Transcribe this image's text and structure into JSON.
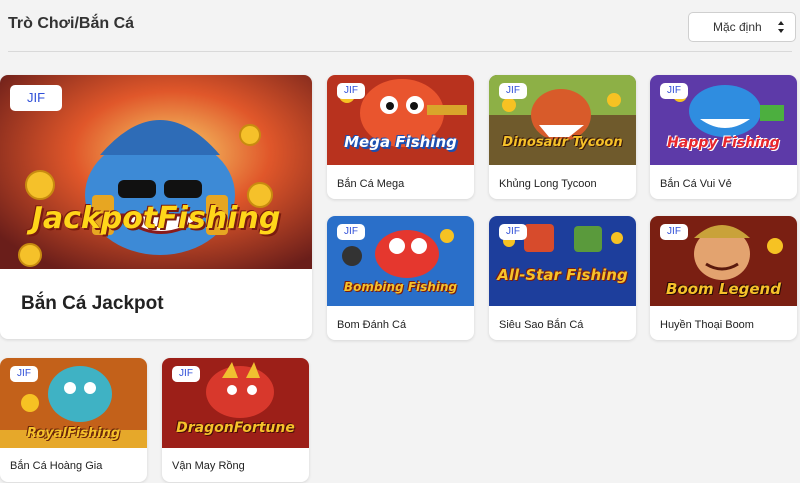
{
  "header": {
    "title": "Trò Chơi/Bắn Cá",
    "sort_label": "Mặc định"
  },
  "badge": "JIF",
  "games": [
    {
      "name": "Bắn Cá Jackpot",
      "logo": "JackpotFishing",
      "colors": {
        "bg": "#c0391b",
        "accent": "#f7c21b"
      }
    },
    {
      "name": "Bắn Cá Mega",
      "logo": "Mega Fishing",
      "colors": {
        "bg": "#b8321e",
        "accent": "#2e6fe0"
      }
    },
    {
      "name": "Khủng Long Tycoon",
      "logo": "Dinosaur Tycoon",
      "colors": {
        "bg": "#a8461c",
        "accent": "#f2b33a"
      }
    },
    {
      "name": "Bắn Cá Vui Vẻ",
      "logo": "Happy Fishing",
      "colors": {
        "bg": "#5d3aa8",
        "accent": "#e8262c"
      }
    },
    {
      "name": "Bom Đánh Cá",
      "logo": "Bombing Fishing",
      "colors": {
        "bg": "#2a6fc9",
        "accent": "#e5372e"
      }
    },
    {
      "name": "Siêu Sao Bắn Cá",
      "logo": "All-Star Fishing",
      "colors": {
        "bg": "#1d3e9c",
        "accent": "#f5c11d"
      }
    },
    {
      "name": "Huyền Thoại Boom",
      "logo": "Boom Legend",
      "colors": {
        "bg": "#7a1f12",
        "accent": "#f5b827"
      }
    },
    {
      "name": "Bắn Cá Hoàng Gia",
      "logo": "RoyalFishing",
      "colors": {
        "bg": "#c3611a",
        "accent": "#f6c21f"
      }
    },
    {
      "name": "Vận May Rồng",
      "logo": "DragonFortune",
      "colors": {
        "bg": "#9c1f18",
        "accent": "#f5c623"
      }
    }
  ]
}
